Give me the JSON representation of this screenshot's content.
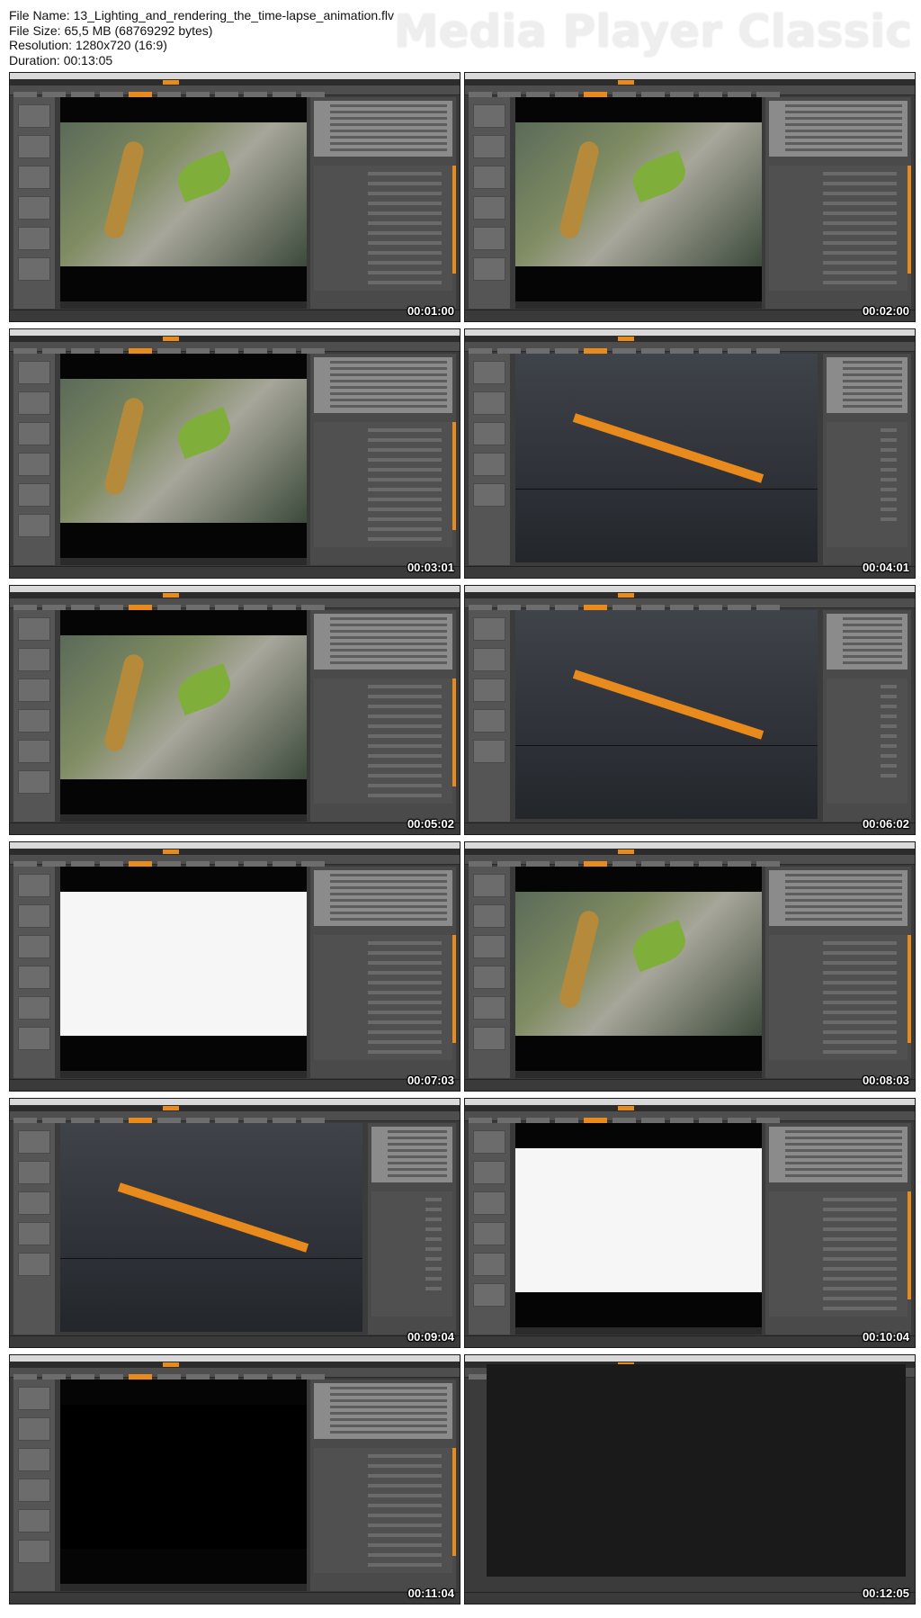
{
  "file": {
    "name_line": "File Name: 13_Lighting_and_rendering_the_time-lapse_animation.flv",
    "size_line": "File Size: 65,5 MB (68769292 bytes)",
    "resolution_line": "Resolution: 1280x720 (16:9)",
    "duration_line": "Duration: 00:13:05"
  },
  "brand": "Media Player Classic",
  "thumbnails": [
    {
      "timestamp": "00:01:00",
      "scene": "photo"
    },
    {
      "timestamp": "00:02:00",
      "scene": "photo"
    },
    {
      "timestamp": "00:03:01",
      "scene": "photo"
    },
    {
      "timestamp": "00:04:01",
      "scene": "viewport"
    },
    {
      "timestamp": "00:05:02",
      "scene": "photo"
    },
    {
      "timestamp": "00:06:02",
      "scene": "viewport"
    },
    {
      "timestamp": "00:07:03",
      "scene": "white"
    },
    {
      "timestamp": "00:08:03",
      "scene": "photo"
    },
    {
      "timestamp": "00:09:04",
      "scene": "viewport"
    },
    {
      "timestamp": "00:10:04",
      "scene": "white"
    },
    {
      "timestamp": "00:11:04",
      "scene": "black"
    },
    {
      "timestamp": "00:12:05",
      "scene": "render"
    }
  ]
}
